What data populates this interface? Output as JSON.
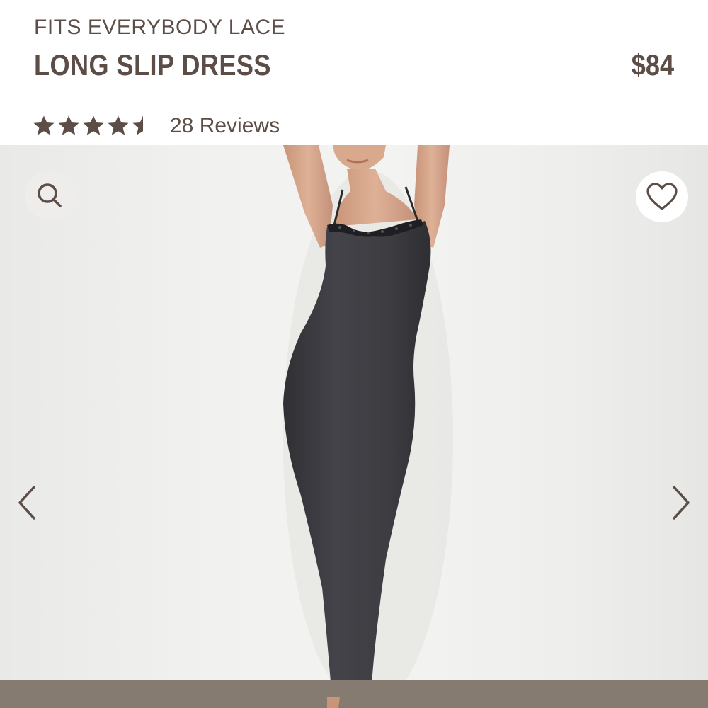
{
  "product": {
    "collection": "FITS EVERYBODY LACE",
    "title": "LONG SLIP DRESS",
    "price": "$84"
  },
  "rating": {
    "stars_value": 4.5,
    "stars_max": 5,
    "reviews_label": "28 Reviews"
  },
  "icons": {
    "search": "search-icon",
    "favorite": "heart-icon",
    "previous": "chevron-left-icon",
    "next": "chevron-right-icon"
  },
  "colors": {
    "text": "#5c4e46",
    "star": "#5c4e46",
    "dress": "#3f3f44",
    "background": "#f1f1ef",
    "floor": "#857b71"
  }
}
